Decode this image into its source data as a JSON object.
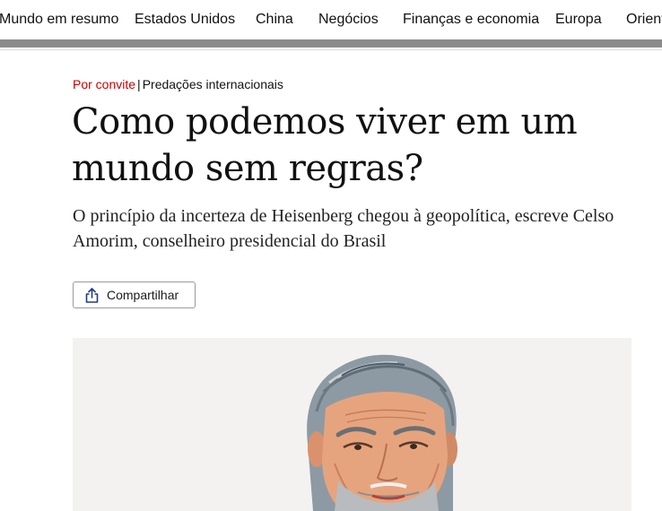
{
  "nav": {
    "items": [
      {
        "label": "Mundo em resumo"
      },
      {
        "label": "Estados Unidos"
      },
      {
        "label": "China"
      },
      {
        "label": "Negócios"
      },
      {
        "label": "Finanças e economia"
      },
      {
        "label": "Europa"
      },
      {
        "label": "Oriente"
      }
    ]
  },
  "article": {
    "kicker_label": "Por convite",
    "kicker_separator": "|",
    "series": "Predações internacionais",
    "headline": "Como podemos viver em um mundo sem regras?",
    "standfirst": "O princípio da incerteza de Heisenberg chegou à geopolítica, escreve Celso Amorim, conselheiro presidencial do Brasil",
    "share_label": "Compartilhar",
    "share_icon": "share-icon",
    "hero_image": "portrait-illustration"
  },
  "colors": {
    "accent_red": "#cc0000",
    "share_icon_blue": "#1f3a8a",
    "hero_background": "#f3f2f1"
  }
}
